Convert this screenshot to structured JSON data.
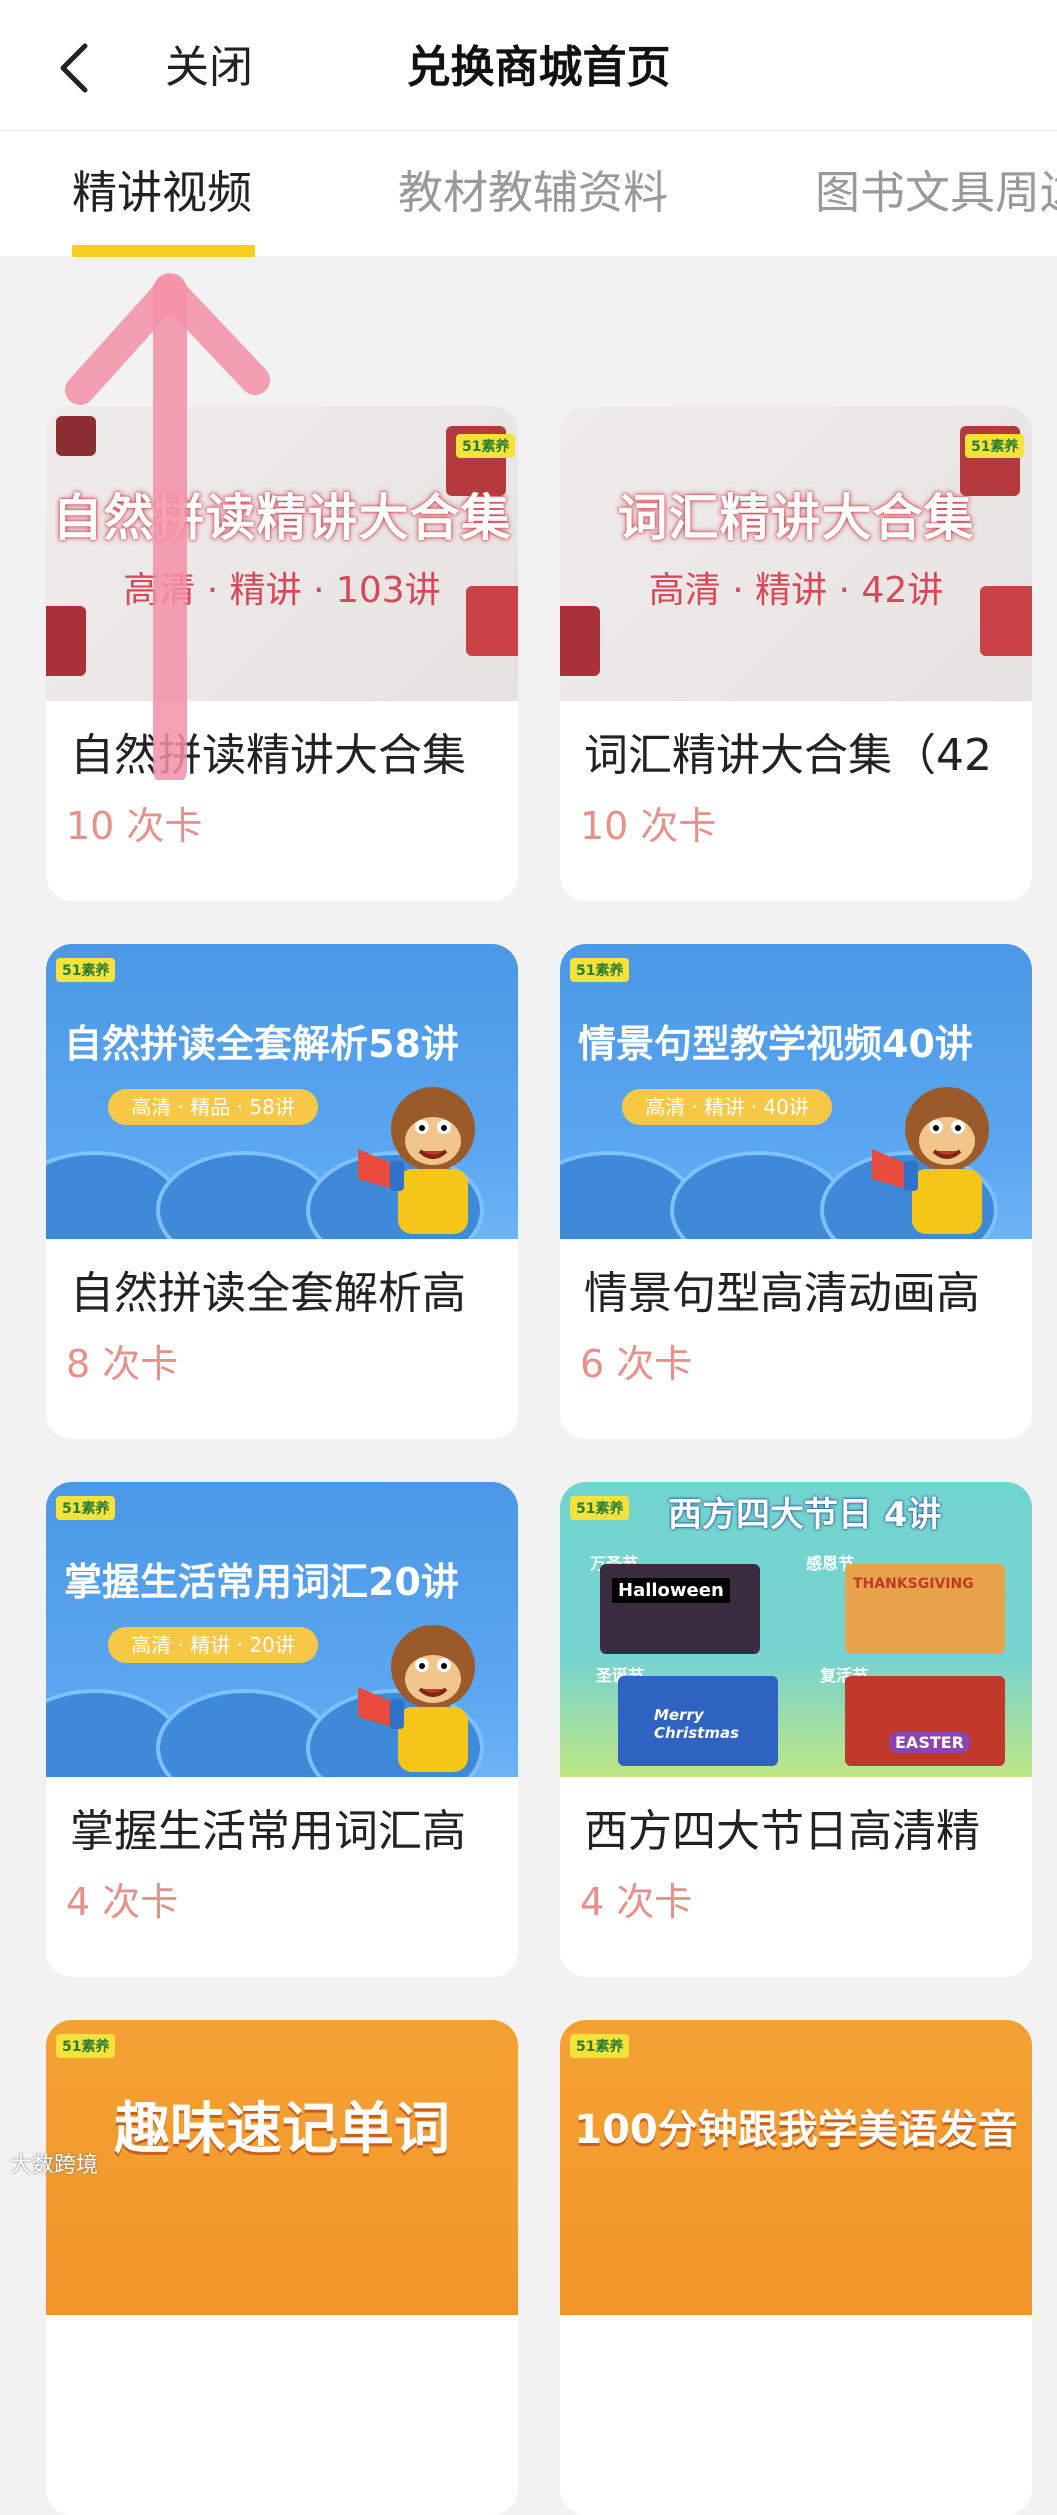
{
  "header": {
    "close_label": "关闭",
    "title": "兑换商城首页"
  },
  "tabs": [
    {
      "label": "精讲视频",
      "active": true
    },
    {
      "label": "教材教辅资料",
      "active": false
    },
    {
      "label": "图书文具周边",
      "active": false
    }
  ],
  "colors": {
    "accent": "#f7cf1f",
    "price": "#e8908a"
  },
  "products": [
    {
      "banner_title": "自然拼读精讲大合集",
      "banner_sub": "高清 · 精讲 · 103讲",
      "title": "自然拼读精讲大合集",
      "price": "10 次卡"
    },
    {
      "banner_title": "词汇精讲大合集",
      "banner_sub": "高清 · 精讲 · 42讲",
      "title": "词汇精讲大合集（42",
      "price": "10 次卡"
    },
    {
      "banner_tag": "51素养",
      "banner_title": "自然拼读全套解析58讲",
      "banner_sub": "高清 · 精品 · 58讲",
      "title": "自然拼读全套解析高",
      "price": "8 次卡"
    },
    {
      "banner_tag": "51素养",
      "banner_title": "情景句型教学视频40讲",
      "banner_sub": "高清 · 精讲 · 40讲",
      "title": "情景句型高清动画高",
      "price": "6 次卡"
    },
    {
      "banner_tag": "51素养",
      "banner_title": "掌握生活常用词汇20讲",
      "banner_sub": "高清 · 精讲 · 20讲",
      "title": "掌握生活常用词汇高",
      "price": "4 次卡"
    },
    {
      "banner_tag": "51素养",
      "banner_title": "西方四大节日 4讲",
      "holiday_labels": [
        "万圣节",
        "感恩节",
        "圣诞节",
        "复活节"
      ],
      "holiday_captions": [
        "Halloween",
        "THANKSGIVING",
        "Merry Christmas",
        "EASTER"
      ],
      "title": "西方四大节日高清精",
      "price": "4 次卡"
    },
    {
      "banner_tag": "51素养",
      "banner_title": "趣味速记单词"
    },
    {
      "banner_tag": "51素养",
      "banner_title": "100分钟跟我学美语发音"
    }
  ],
  "watermark": "大数跨境"
}
